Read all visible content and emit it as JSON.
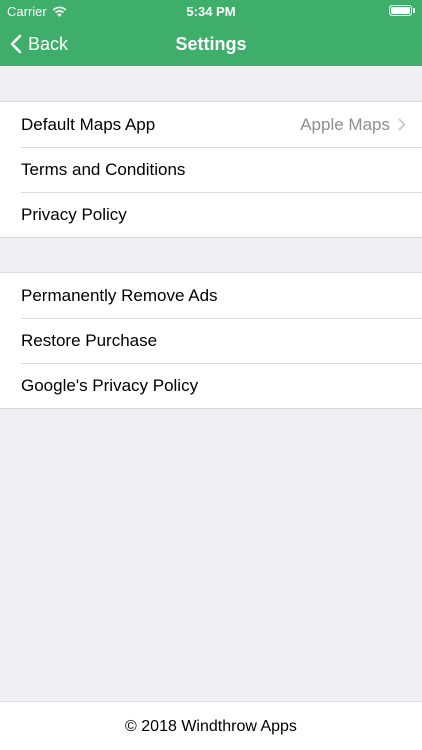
{
  "status_bar": {
    "carrier": "Carrier",
    "time": "5:34 PM",
    "icons": [
      "wifi-icon",
      "battery-icon"
    ]
  },
  "nav": {
    "back_label": "Back",
    "title": "Settings",
    "back_icon": "chevron-left-icon"
  },
  "colors": {
    "header_background": "#3fae6b",
    "page_background": "#efeff4",
    "secondary_text": "#8e8e93"
  },
  "groups": [
    {
      "items": [
        {
          "label": "Default Maps App",
          "value": "Apple Maps",
          "accessory": "chevron-right-icon"
        },
        {
          "label": "Terms and Conditions"
        },
        {
          "label": "Privacy Policy"
        }
      ]
    },
    {
      "items": [
        {
          "label": "Permanently Remove Ads"
        },
        {
          "label": "Restore Purchase"
        },
        {
          "label": "Google's Privacy Policy"
        }
      ]
    }
  ],
  "footer": {
    "text": "© 2018 Windthrow Apps"
  }
}
